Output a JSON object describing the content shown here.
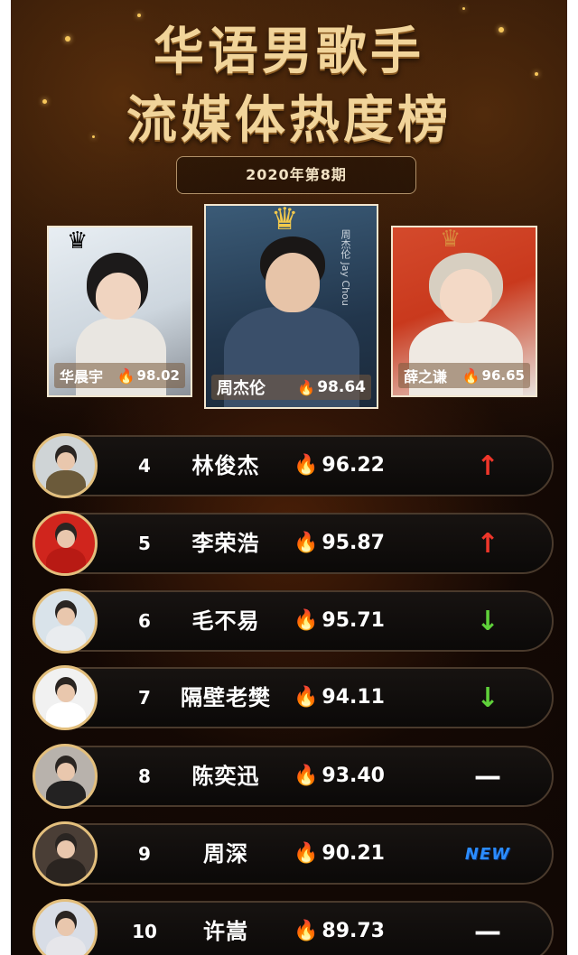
{
  "title_line1": "华语男歌手",
  "title_line2": "流媒体热度榜",
  "period": "2020年第8期",
  "top3": [
    {
      "name": "华晨宇",
      "score": "98.02",
      "crown": "silver",
      "side_text": ""
    },
    {
      "name": "周杰伦",
      "score": "98.64",
      "crown": "gold",
      "side_text": "周杰伦 Jay Chou"
    },
    {
      "name": "薛之谦",
      "score": "96.65",
      "crown": "bronze",
      "side_text": ""
    }
  ],
  "ranking": [
    {
      "rank": "4",
      "name": "林俊杰",
      "score": "96.22",
      "trend": "up",
      "trend_symbol": "↑"
    },
    {
      "rank": "5",
      "name": "李荣浩",
      "score": "95.87",
      "trend": "up",
      "trend_symbol": "↑"
    },
    {
      "rank": "6",
      "name": "毛不易",
      "score": "95.71",
      "trend": "down",
      "trend_symbol": "↓"
    },
    {
      "rank": "7",
      "name": "隔壁老樊",
      "score": "94.11",
      "trend": "down",
      "trend_symbol": "↓"
    },
    {
      "rank": "8",
      "name": "陈奕迅",
      "score": "93.40",
      "trend": "same",
      "trend_symbol": "—"
    },
    {
      "rank": "9",
      "name": "周深",
      "score": "90.21",
      "trend": "new",
      "trend_symbol": "NEW"
    },
    {
      "rank": "10",
      "name": "许嵩",
      "score": "89.73",
      "trend": "same",
      "trend_symbol": "—"
    }
  ],
  "colors": {
    "up": "#f0362a",
    "down": "#5fd13a",
    "new": "#2b8cff",
    "gold": "#e3bf7d"
  },
  "icons": {
    "score": "fire-icon",
    "top1": "crown-icon"
  }
}
